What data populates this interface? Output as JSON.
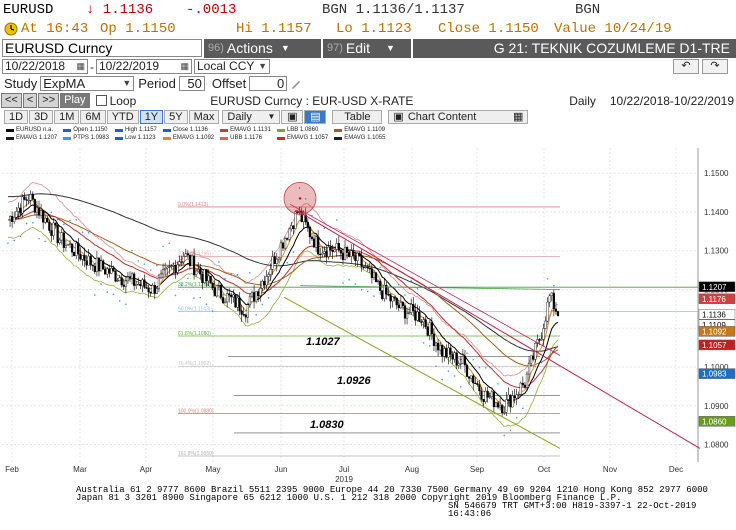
{
  "quote": {
    "symbol": "EURUSD",
    "last": "↓ 1.1136",
    "change": "-.0013",
    "bgn_quote": "BGN  1.1136/1.1137",
    "bgn_label": "BGN",
    "at_label": "At",
    "time": "16:43",
    "op_label": "Op",
    "open": "1.1150",
    "hi_label": "Hi",
    "high": "1.1157",
    "lo_label": "Lo",
    "low": "1.1123",
    "close_label": "Close",
    "close": "1.1150",
    "value_label": "Value",
    "value_date": "10/24/19"
  },
  "toolbar": {
    "ticker": "EURUSD  Curncy",
    "actions_num": "96)",
    "actions_label": "Actions",
    "edit_num": "97)",
    "edit_label": "Edit",
    "title": "G 21: TEKNIK COZUMLEME D1-TRE"
  },
  "range": {
    "start_date": "10/22/2018",
    "end_date": "10/22/2019",
    "currency": "Local CCY",
    "undo_icon": "↶",
    "redo_icon": "↷"
  },
  "study": {
    "label": "Study",
    "value": "ExpMA",
    "period_label": "Period",
    "period": "50",
    "offset_label": "Offset",
    "offset": "0"
  },
  "playback": {
    "rew": "<<",
    "back": "<",
    "fwd": ">>",
    "play": "Play",
    "loop": "Loop",
    "security": "EURUSD  Curncy : EUR-USD X-RATE",
    "frequency": "Daily",
    "period_range": "10/22/2018-10/22/2019"
  },
  "tabs": {
    "ranges": [
      "1D",
      "3D",
      "1M",
      "6M",
      "YTD",
      "1Y",
      "5Y",
      "Max"
    ],
    "selected": "1Y",
    "frequency": "Daily",
    "table": "Table",
    "chart_content": "Chart Content"
  },
  "legend": [
    {
      "label": "EURUSD  n.a.",
      "color": "#000000"
    },
    {
      "label": "EMAVG  1.1207",
      "color": "#1a1a1a"
    },
    {
      "label": "Open  1.1150",
      "color": "#2060c0"
    },
    {
      "label": "PTPS  1.0983",
      "color": "#3399ff"
    },
    {
      "label": "High  1.1157",
      "color": "#2060c0"
    },
    {
      "label": "Low  1.1123",
      "color": "#2060c0"
    },
    {
      "label": "Close  1.1136",
      "color": "#2060c0"
    },
    {
      "label": "EMAVG  1.1092",
      "color": "#d09030"
    },
    {
      "label": "EMAVG  1.1131",
      "color": "#c04040"
    },
    {
      "label": "UBB  1.1176",
      "color": "#e06060"
    },
    {
      "label": "LBB  1.0860",
      "color": "#80a040"
    },
    {
      "label": "EMAVG  1.1057",
      "color": "#c03030"
    },
    {
      "label": "EMAVG  1.1109",
      "color": "#a06020"
    },
    {
      "label": "EMAVG  1.1055",
      "color": "#202020"
    }
  ],
  "chart_data": {
    "type": "candlestick",
    "title": "",
    "xlabel": "",
    "ylabel": "",
    "year_label": "2019",
    "months": [
      "Feb",
      "Mar",
      "Apr",
      "May",
      "Jun",
      "Jul",
      "Aug",
      "Sep",
      "Oct",
      "Nov",
      "Dec"
    ],
    "y_ticks": [
      "1.1500",
      "1.1400",
      "1.1300",
      "1.1200",
      "1.1100",
      "1.1000",
      "1.0900",
      "1.0800"
    ],
    "ylim": [
      1.0755,
      1.1565
    ],
    "price_labels": [
      {
        "text": "1.1207",
        "color": "#ffffff",
        "bg": "#000000"
      },
      {
        "text": "1.1176",
        "color": "#ffffff",
        "bg": "#d04040"
      },
      {
        "text": "1.1136",
        "color": "#000000",
        "bg": "#ffffff"
      },
      {
        "text": "1.1109",
        "color": "#000000",
        "bg": "#ffffff"
      },
      {
        "text": "1.1092",
        "color": "#ffffff",
        "bg": "#c47818"
      },
      {
        "text": "1.1057",
        "color": "#ffffff",
        "bg": "#c02020"
      },
      {
        "text": "1.0983",
        "color": "#ffffff",
        "bg": "#1e6ec8"
      },
      {
        "text": "1.0860",
        "color": "#ffffff",
        "bg": "#6a9a20"
      }
    ],
    "annotations": [
      "1.1027",
      "1.0926",
      "1.0830"
    ],
    "fib_levels": [
      {
        "text": "0.0%(1.1413)"
      },
      {
        "text": "23.6%(1.1285)"
      },
      {
        "text": "38.2%(1.1206)"
      },
      {
        "text": "50.0%(1.1143)"
      },
      {
        "text": "61.8%(1.1080)"
      },
      {
        "text": "76.4%(1.1002)"
      },
      {
        "text": "100.0%(1.0880)"
      },
      {
        "text": "161.8%(1.0550)"
      }
    ]
  },
  "footer": {
    "line1": "Australia 61 2 9777 8600 Brazil 5511 2395 9000 Europe 44 20 7330 7500 Germany 49 69 9204 1210 Hong Kong 852 2977 6000",
    "line2": "Japan 81 3 3201 8900        Singapore 65 6212 1000        U.S. 1 212 318 2000           Copyright 2019 Bloomberg Finance L.P.",
    "line3": "SN 546679 TRT  GMT+3:00 H819-3397-1 22-Oct-2019 16:43:06"
  }
}
